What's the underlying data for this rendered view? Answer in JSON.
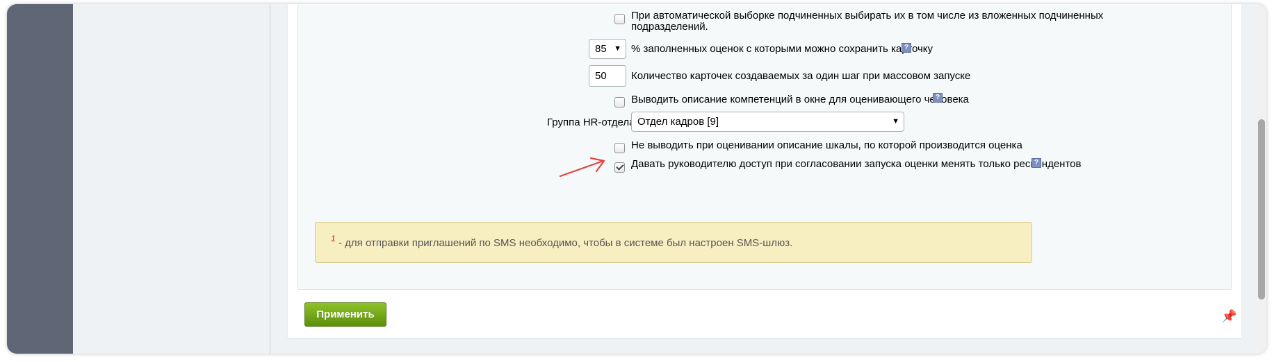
{
  "settings": {
    "auto_select_nested": {
      "line1": "При автоматической выборке подчиненных выбирать их в том числе из вложенных подчиненных",
      "line2": "подразделений.",
      "checked": false
    },
    "percent_filled": {
      "value": "85",
      "label": "% заполненных оценок с которыми можно сохранить карточку"
    },
    "cards_per_step": {
      "value": "50",
      "label": "Количество карточек создаваемых за один шаг при массовом запуске"
    },
    "show_competency_desc": {
      "label": "Выводить описание компетенций в окне для оценивающего человека",
      "checked": false
    },
    "hr_group": {
      "label": "Группа HR-отдела:",
      "selected": "Отдел кадров [9]"
    },
    "hide_scale_desc": {
      "label": "Не выводить при оценивании описание шкалы, по которой производится оценка",
      "checked": false
    },
    "manager_access": {
      "label": "Давать руководителю доступ при согласовании запуска оценки менять только респондентов",
      "checked": true
    }
  },
  "note": {
    "marker": "1",
    "text": "- для отправки приглашений по SMS необходимо, чтобы в системе был настроен SMS-шлюз."
  },
  "actions": {
    "apply_label": "Применить"
  },
  "icons": {
    "help": "help-icon",
    "pin": "pin-icon",
    "chevron": "chevron-down-icon",
    "annotation": "arrow-annotation-icon"
  },
  "colors": {
    "apply_button": "#6fa51a",
    "note_bg": "#f7eec1",
    "annotation_arrow": "#e8413e",
    "help_icon": "#7d91bf"
  }
}
